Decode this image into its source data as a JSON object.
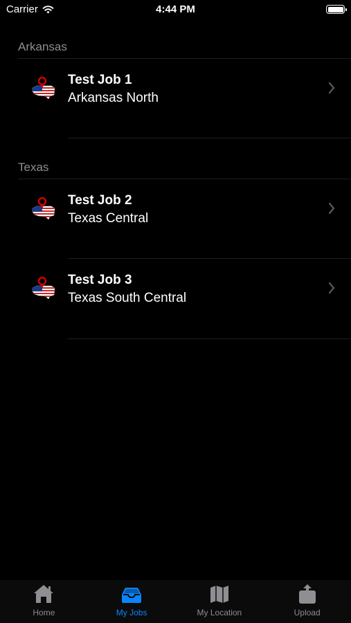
{
  "status_bar": {
    "carrier": "Carrier",
    "time": "4:44 PM"
  },
  "sections": [
    {
      "header": "Arkansas",
      "jobs": [
        {
          "title": "Test Job 1",
          "subtitle": "Arkansas North"
        }
      ]
    },
    {
      "header": "Texas",
      "jobs": [
        {
          "title": "Test Job 2",
          "subtitle": "Texas Central"
        },
        {
          "title": "Test Job 3",
          "subtitle": "Texas South Central"
        }
      ]
    }
  ],
  "tab_bar": {
    "home": "Home",
    "my_jobs": "My Jobs",
    "my_location": "My Location",
    "upload": "Upload",
    "active_tab": "my_jobs"
  },
  "colors": {
    "background": "#000000",
    "active_tint": "#0a84ff",
    "inactive_tint": "#8e8e93"
  }
}
